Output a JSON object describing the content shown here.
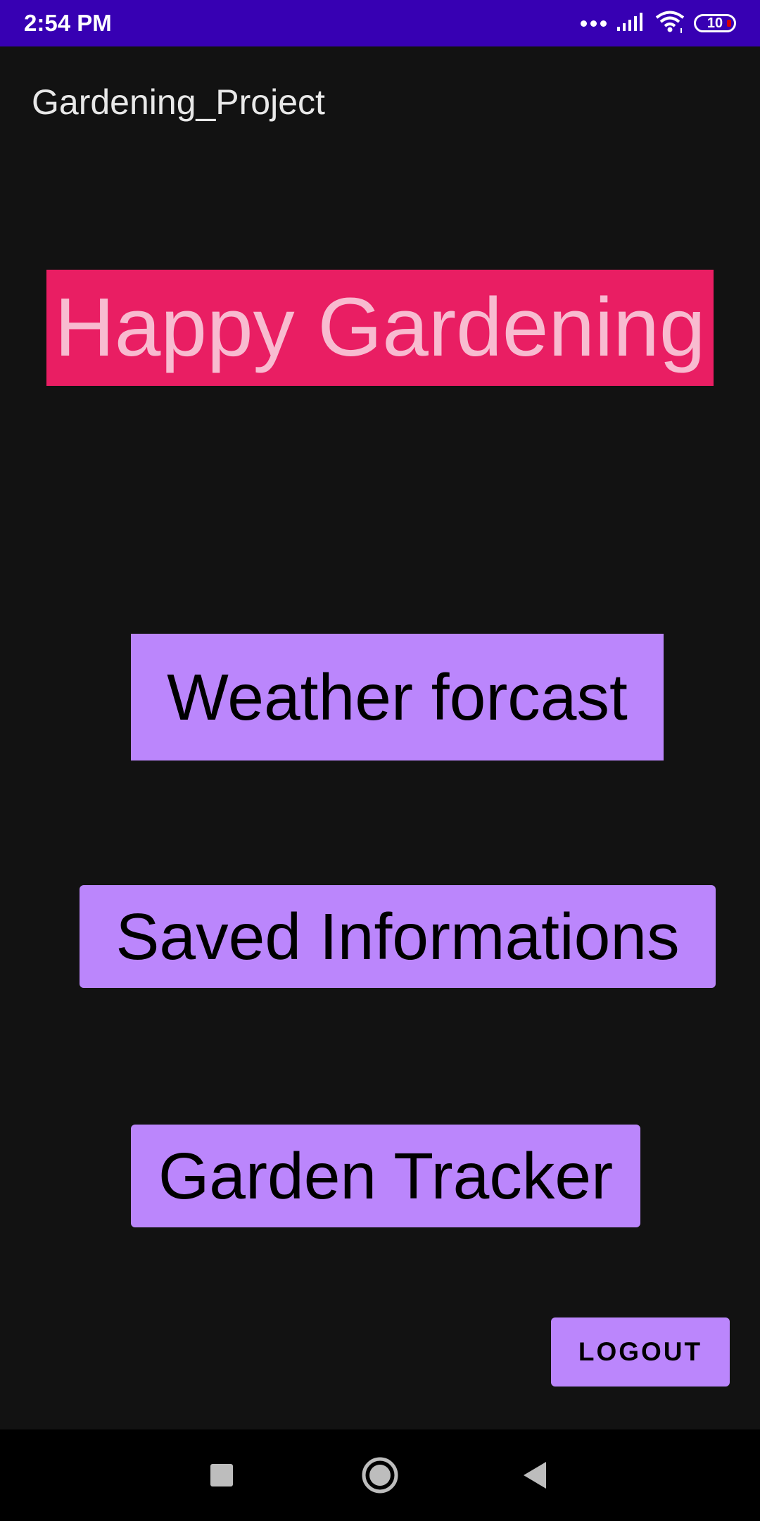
{
  "status_bar": {
    "time": "2:54 PM",
    "battery_level": "10",
    "icons": [
      "more-dots-icon",
      "signal-icon",
      "wifi-icon",
      "battery-icon"
    ]
  },
  "toolbar": {
    "title": "Gardening_Project"
  },
  "banner": {
    "text": "Happy Gardening"
  },
  "buttons": {
    "weather": "Weather forcast",
    "saved": "Saved Informations",
    "tracker": "Garden Tracker",
    "logout": "LOGOUT"
  },
  "nav_bar": {
    "icons": [
      "recents-square-icon",
      "home-circle-icon",
      "back-triangle-icon"
    ]
  },
  "colors": {
    "status_bar": "#3700B3",
    "background": "#121212",
    "banner_bg": "#E91E63",
    "banner_text": "#F8BBD0",
    "button_bg": "#BB86FC",
    "button_text": "#000000"
  }
}
